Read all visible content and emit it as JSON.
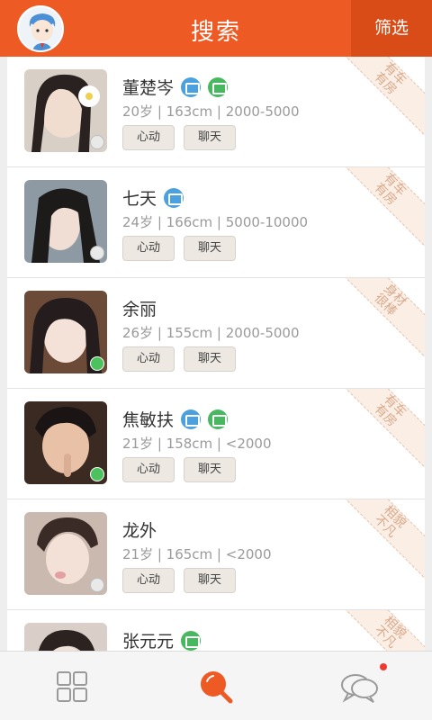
{
  "header": {
    "title": "搜索",
    "filter_label": "筛选",
    "accent": "#ee5a24"
  },
  "people": [
    {
      "name": "董楚岑",
      "info": "20岁 | 163cm | 2000-5000",
      "corner": "有车\n有房",
      "badges": [
        "blue",
        "green"
      ],
      "status": "clock"
    },
    {
      "name": "七天",
      "info": "24岁 | 166cm | 5000-10000",
      "corner": "有车\n有房",
      "badges": [
        "blue"
      ],
      "status": "clock"
    },
    {
      "name": "余丽",
      "info": "26岁 | 155cm | 2000-5000",
      "corner": "身材\n很棒",
      "badges": [],
      "status": "check"
    },
    {
      "name": "焦敏扶",
      "info": "21岁 | 158cm | <2000",
      "corner": "有车\n有房",
      "badges": [
        "blue",
        "green"
      ],
      "status": "check"
    },
    {
      "name": "龙外",
      "info": "21岁 | 165cm | <2000",
      "corner": "相貌\n不凡",
      "badges": [],
      "status": "clock"
    },
    {
      "name": "张元元",
      "info": "",
      "corner": "相貌\n不凡",
      "badges": [
        "green"
      ],
      "status": "clock"
    }
  ],
  "actions": {
    "like": "心动",
    "chat": "聊天"
  },
  "tabs": [
    {
      "icon": "grid-icon"
    },
    {
      "icon": "search-icon"
    },
    {
      "icon": "chat-bubbles-icon"
    }
  ]
}
